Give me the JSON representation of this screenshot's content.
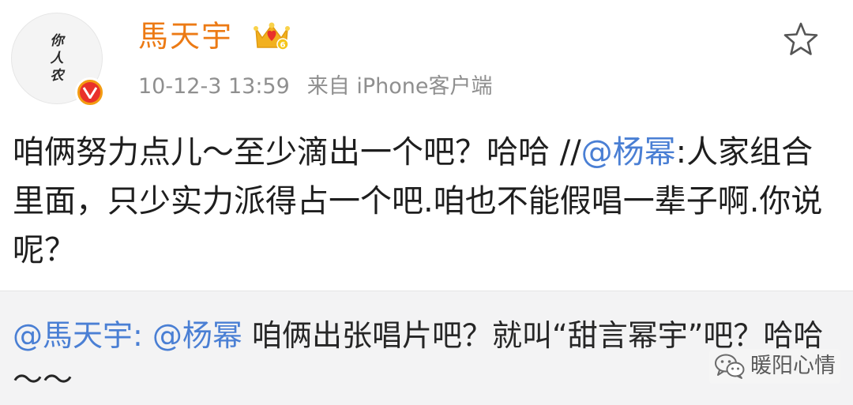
{
  "post": {
    "avatar_text": [
      "你",
      "人",
      "农"
    ],
    "username": "馬天宇",
    "timestamp": "10-12-3 13:59",
    "source": "来自 iPhone客户端",
    "text_before": "咱俩努力点儿～至少滴出一个吧？哈哈 //",
    "mention": "@杨幂",
    "text_after": ":人家组合里面，只少实力派得占一个吧.咱也不能假唱一辈子啊.你说呢？"
  },
  "repost": {
    "author_mention": "@馬天宇",
    "separator": ": ",
    "mention": "@杨幂",
    "text": " 咱俩出张唱片吧？就叫“甜言幂宇”吧？哈哈～～"
  },
  "watermark": {
    "label": "暖阳心情"
  },
  "colors": {
    "username": "#ec7a14",
    "mention": "#4a7fd4",
    "meta": "#8f8f8f",
    "repost_bg": "#f3f3f4"
  },
  "icons": {
    "verified": "verified-badge-icon",
    "vip": "vip-crown-icon",
    "favorite": "star-icon",
    "wechat": "wechat-icon"
  }
}
